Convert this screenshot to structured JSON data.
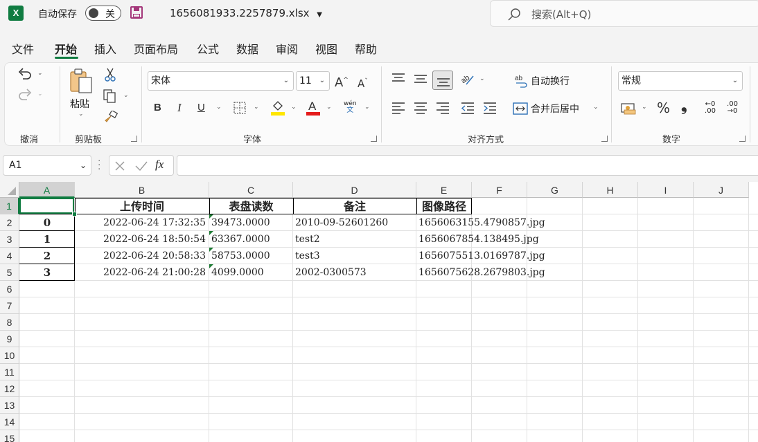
{
  "titlebar": {
    "logo": "X",
    "autosave_label": "自动保存",
    "autosave_state": "关",
    "filename": "1656081933.2257879.xlsx",
    "search_placeholder": "搜索(Alt+Q)"
  },
  "menu": [
    "文件",
    "开始",
    "插入",
    "页面布局",
    "公式",
    "数据",
    "审阅",
    "视图",
    "帮助"
  ],
  "ribbon": {
    "undo_group": "撤消",
    "clipboard_group": "剪贴板",
    "paste_label": "粘贴",
    "font_group": "字体",
    "font_name": "宋体",
    "font_size": "11",
    "bold": "B",
    "italic": "I",
    "underline": "U",
    "phonetic_top": "wén",
    "phonetic_bottom": "文",
    "align_group": "对齐方式",
    "wrap_text": "自动换行",
    "merge_center": "合并后居中",
    "number_group": "数字",
    "number_format": "常规",
    "percent": "%",
    "comma": "❟",
    "inc_decimal": "←0 .00",
    "dec_decimal": ".00 →0"
  },
  "formula_bar": {
    "name_box": "A1",
    "fx": "fx",
    "formula": ""
  },
  "sheet": {
    "columns": [
      "A",
      "B",
      "C",
      "D",
      "E",
      "F",
      "G",
      "H",
      "I",
      "J"
    ],
    "rows": [
      "1",
      "2",
      "3",
      "4",
      "5",
      "6",
      "7",
      "8",
      "9",
      "10",
      "11",
      "12",
      "13",
      "14",
      "15"
    ],
    "headers": [
      "",
      "上传时间",
      "表盘读数",
      "备注",
      "图像路径"
    ],
    "data": [
      [
        "0",
        "2022-06-24 17:32:35",
        "39473.0000",
        "2010-09-52601260",
        "1656063155.4790857.jpg"
      ],
      [
        "1",
        "2022-06-24 18:50:54",
        "63367.0000",
        "test2",
        "1656067854.138495.jpg"
      ],
      [
        "2",
        "2022-06-24 20:58:33",
        "58753.0000",
        "test3",
        "1656075513.0169787.jpg"
      ],
      [
        "3",
        "2022-06-24 21:00:28",
        "4099.0000",
        "2002-0300573",
        "1656075628.2679803.jpg"
      ]
    ]
  }
}
